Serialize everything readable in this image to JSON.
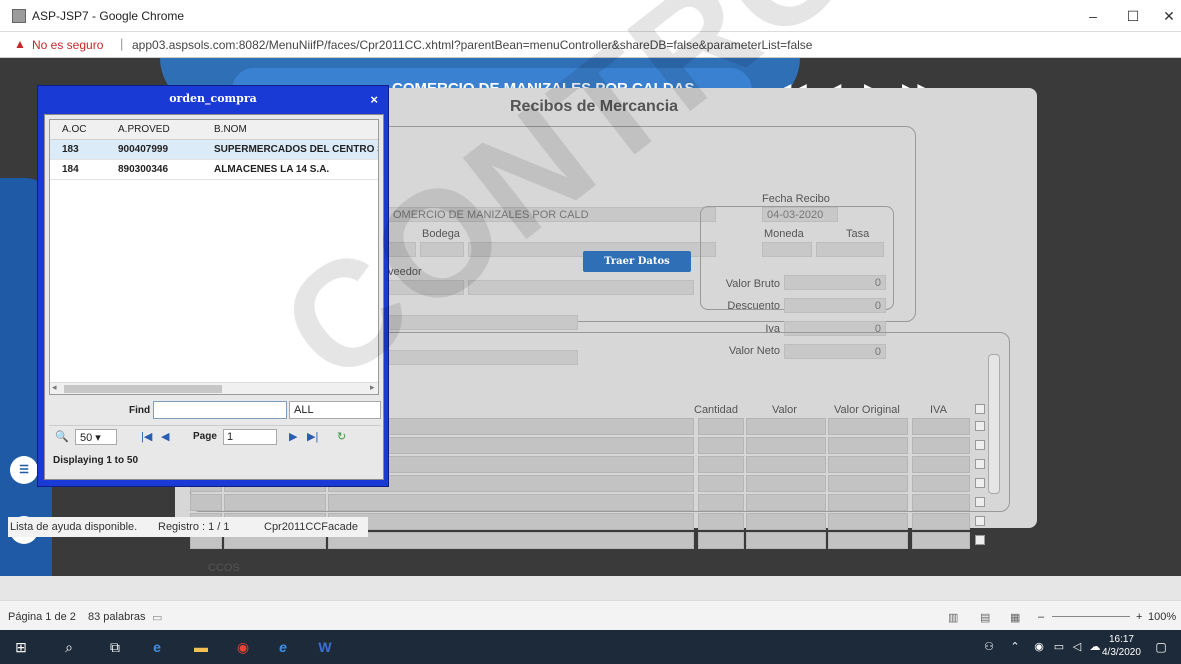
{
  "window": {
    "title": "ASP-JSP7 - Google Chrome",
    "minimize": "–",
    "maximize": "☐",
    "close": "✕"
  },
  "address": {
    "warning_icon": "▲",
    "insecure_label": "No es seguro",
    "separator": "|",
    "url": "app03.aspsols.com:8082/MenuNiifP/faces/Cpr2011CC.xhtml?parentBean=menuController&shareDB=false&parameterList=false"
  },
  "header": {
    "empresa": "COMERCIO DE MANIZALES POR CALDAS",
    "nav": [
      "◀◀",
      "◀",
      "▶",
      "▶▶"
    ]
  },
  "rail_icons": [
    "e",
    "A-Z"
  ],
  "form": {
    "title": "Recibos de Mercancia",
    "empresa_value": "OMERCIO DE MANIZALES POR CALD",
    "bodega_label": "Bodega",
    "proveedor_label": "veedor",
    "fecha_label": "Fecha Recibo",
    "fecha_value": "04-03-2020",
    "moneda_label": "Moneda",
    "tasa_label": "Tasa",
    "traer_button": "Traer Datos",
    "totals": [
      {
        "label": "Valor Bruto",
        "value": "0"
      },
      {
        "label": "Descuento",
        "value": "0"
      },
      {
        "label": "Iva",
        "value": "0"
      },
      {
        "label": "Valor Neto",
        "value": "0"
      }
    ],
    "grid_headers": [
      "Cantidad",
      "Valor",
      "Valor Original",
      "IVA"
    ],
    "ccos_label": "CCOS"
  },
  "status": {
    "help": "Lista de ayuda disponible.",
    "registro": "Registro : 1 / 1",
    "facade": "Cpr2011CCFacade"
  },
  "modal": {
    "title": "orden_compra",
    "close": "×",
    "columns": [
      "A.OC",
      "A.PROVED",
      "B.NOM"
    ],
    "rows": [
      {
        "oc": "183",
        "proved": "900407999",
        "nom": "SUPERMERCADOS DEL CENTRO S.A"
      },
      {
        "oc": "184",
        "proved": "890300346",
        "nom": "ALMACENES LA 14 S.A."
      }
    ],
    "scroll_left": "◂",
    "scroll_right": "▸",
    "find_label": "Find",
    "find_value": "",
    "find_scope": "ALL",
    "per_page": "50 ▾",
    "page_label": "Page",
    "page_value": "1",
    "displaying": "Displaying 1 to 50",
    "pager_icons": [
      "🔍",
      "|◀",
      "◀",
      "▶",
      "▶|",
      "↻"
    ]
  },
  "word": {
    "pagina": "Página 1 de 2",
    "palabras": "83 palabras",
    "zoom": "100%",
    "zoom_minus": "–",
    "zoom_plus": "+"
  },
  "taskbar": {
    "time": "16:17",
    "date": "4/3/2020"
  },
  "watermark": "CONTROLADA"
}
